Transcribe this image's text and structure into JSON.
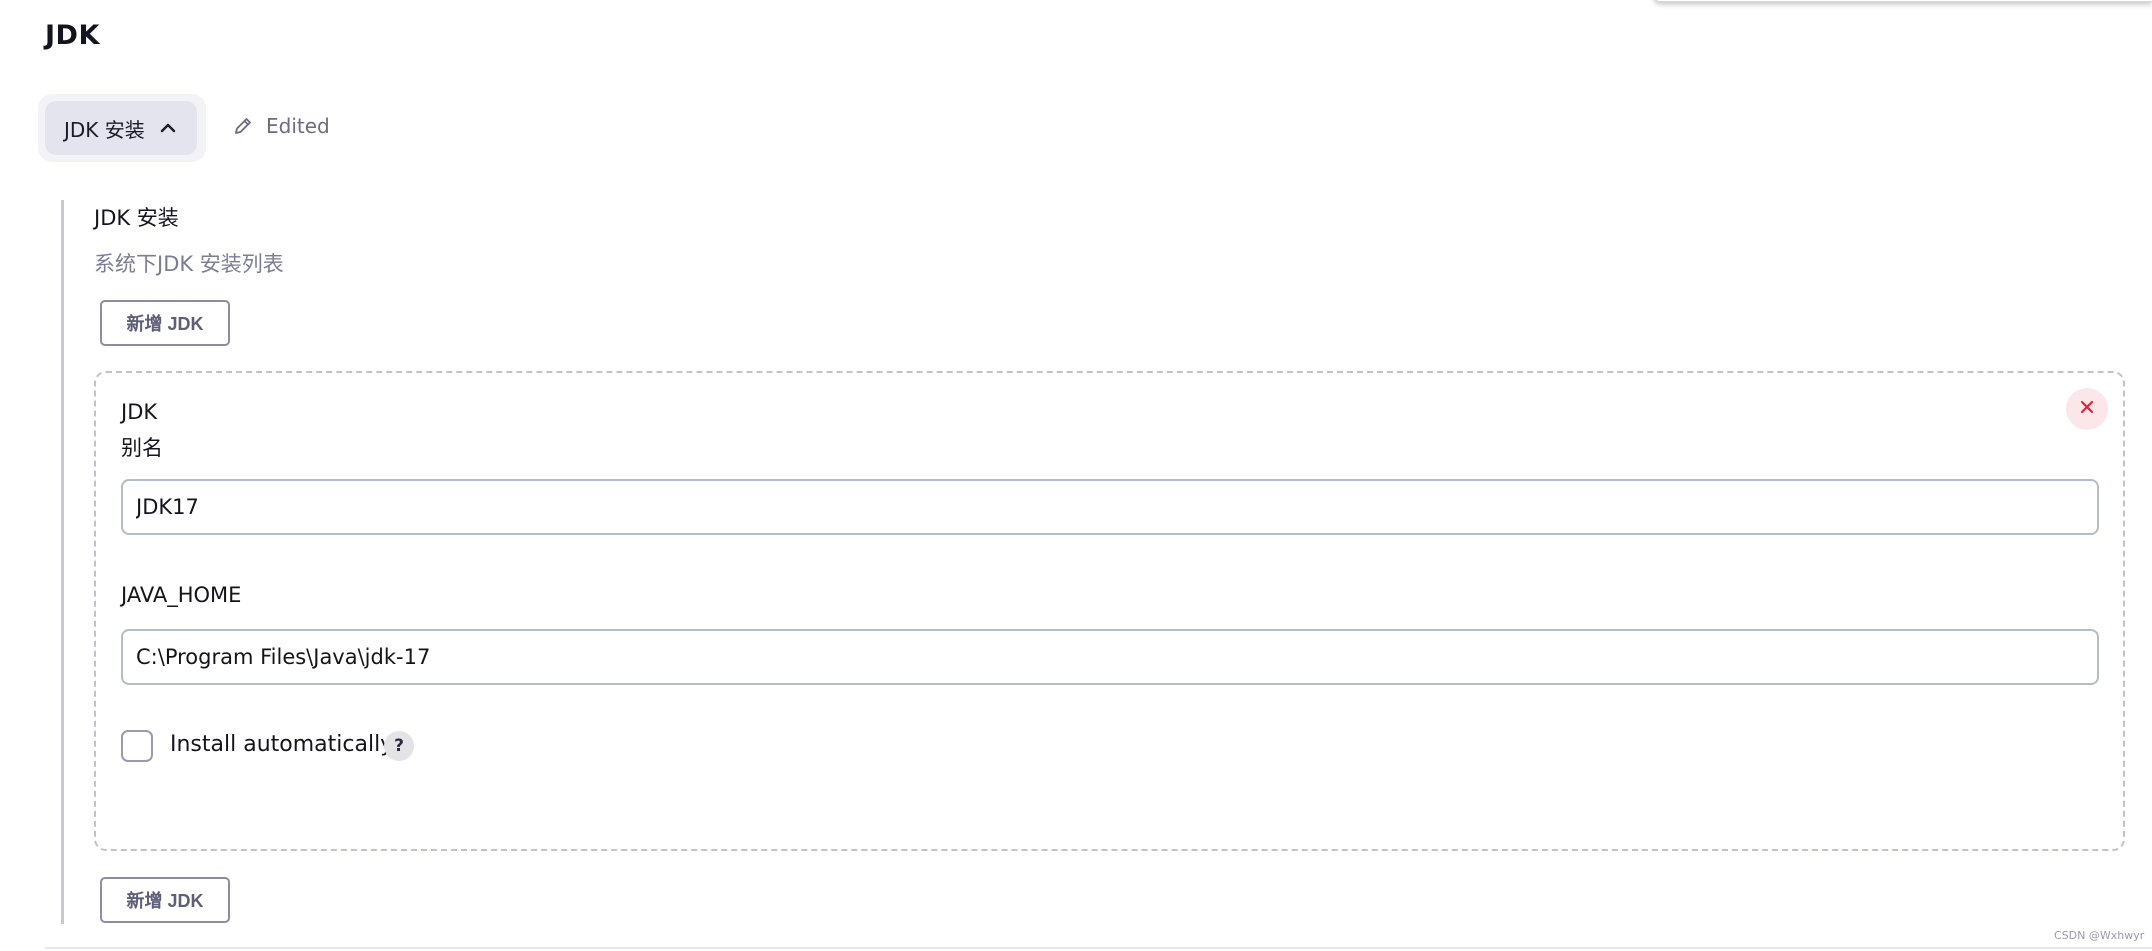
{
  "section": {
    "title": "JDK"
  },
  "toggle": {
    "label": "JDK 安装",
    "icon": "chevron-up-icon",
    "edited_label": "Edited",
    "edited_icon": "pencil-icon"
  },
  "field": {
    "title": "JDK 安装",
    "description": "系统下JDK 安装列表",
    "add_button_label": "新增 JDK"
  },
  "jdk_entry": {
    "header": "JDK",
    "name_label": "别名",
    "name_value": "JDK17",
    "java_home_label": "JAVA_HOME",
    "java_home_value": "C:\\Program Files\\Java\\jdk-17",
    "install_auto_label": "Install automatically",
    "install_auto_checked": false,
    "help_label": "?",
    "close_icon": "close-icon"
  },
  "colors": {
    "close_icon": "#e0243a",
    "close_bg": "#fbe6ea",
    "accent_muted": "#7c7c95"
  },
  "watermark": "CSDN @Wxhwyr"
}
